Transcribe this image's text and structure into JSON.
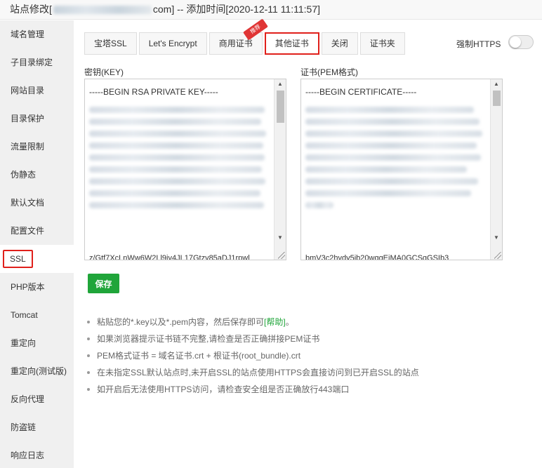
{
  "window": {
    "title_prefix": "站点修改[",
    "title_domain_visible": "com",
    "title_suffix": "] -- 添加时间[2020-12-11 11:11:57]"
  },
  "sidebar": {
    "items": [
      {
        "label": "域名管理"
      },
      {
        "label": "子目录绑定"
      },
      {
        "label": "网站目录"
      },
      {
        "label": "目录保护"
      },
      {
        "label": "流量限制"
      },
      {
        "label": "伪静态"
      },
      {
        "label": "默认文档"
      },
      {
        "label": "配置文件"
      },
      {
        "label": "SSL"
      },
      {
        "label": "PHP版本"
      },
      {
        "label": "Tomcat"
      },
      {
        "label": "重定向"
      },
      {
        "label": "重定向(测试版)"
      },
      {
        "label": "反向代理"
      },
      {
        "label": "防盗链"
      },
      {
        "label": "响应日志"
      }
    ],
    "active_index": 8
  },
  "tabs": [
    {
      "label": "宝塔SSL"
    },
    {
      "label": "Let's Encrypt"
    },
    {
      "label": "商用证书",
      "badge": "推荐"
    },
    {
      "label": "其他证书"
    },
    {
      "label": "关闭"
    },
    {
      "label": "证书夹"
    }
  ],
  "active_tab": 3,
  "force_https": {
    "label": "强制HTTPS",
    "enabled": false
  },
  "key_field": {
    "label": "密钥(KEY)",
    "first_line": "-----BEGIN RSA PRIVATE KEY-----",
    "last_visible_line": "z/Gtf7XcLnWw6W2Ll9iv4JL17Gtzv85aDJ1rpwl"
  },
  "cert_field": {
    "label": "证书(PEM格式)",
    "first_line": "-----BEGIN CERTIFICATE-----",
    "last_visible_line": "bmV3c2hvdy5jb20wggEiMA0GCSqGSIb3"
  },
  "save_button": {
    "label": "保存"
  },
  "notes": [
    {
      "text": "粘贴您的*.key以及*.pem内容，然后保存即可",
      "link": "[帮助]",
      "end": "。"
    },
    {
      "text": "如果浏览器提示证书链不完整,请检查是否正确拼接PEM证书"
    },
    {
      "text": "PEM格式证书 = 域名证书.crt + 根证书(root_bundle).crt"
    },
    {
      "text": "在未指定SSL默认站点时,未开启SSL的站点使用HTTPS会直接访问到已开启SSL的站点"
    },
    {
      "text": "如开启后无法使用HTTPS访问，请检查安全组是否正确放行443端口"
    }
  ],
  "colors": {
    "accent_green": "#20a53a",
    "highlight_red": "#e0201b",
    "sidebar_bg": "#f0f0f0"
  }
}
